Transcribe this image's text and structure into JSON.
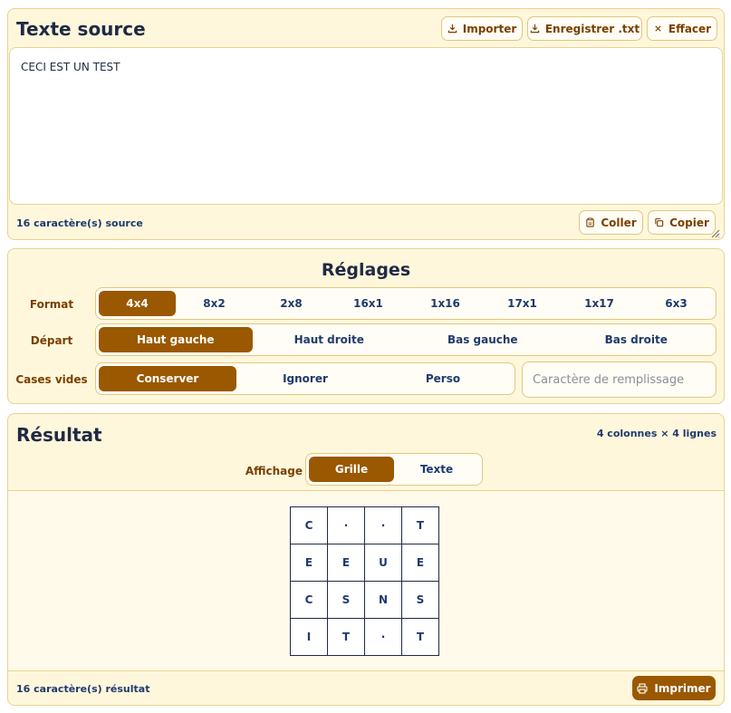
{
  "source_panel": {
    "title": "Texte source",
    "buttons": {
      "import": "Importer",
      "save": "Enregistrer .txt",
      "clear": "Effacer",
      "paste": "Coller",
      "copy": "Copier"
    },
    "text": "CECI EST UN TEST",
    "char_count": "16 caractère(s) source"
  },
  "settings_panel": {
    "title": "Réglages",
    "format": {
      "label": "Format",
      "options": [
        "4x4",
        "8x2",
        "2x8",
        "16x1",
        "1x16",
        "17x1",
        "1x17",
        "6x3"
      ],
      "selected": "4x4"
    },
    "start": {
      "label": "Départ",
      "options": [
        "Haut gauche",
        "Haut droite",
        "Bas gauche",
        "Bas droite"
      ],
      "selected": "Haut gauche"
    },
    "empty_cells": {
      "label": "Cases vides",
      "options": [
        "Conserver",
        "Ignorer",
        "Perso"
      ],
      "selected": "Conserver",
      "fill_placeholder": "Caractère de remplissage",
      "fill_value": ""
    }
  },
  "result_panel": {
    "title": "Résultat",
    "dimensions": "4 colonnes × 4 lignes",
    "view": {
      "label": "Affichage",
      "options": [
        "Grille",
        "Texte"
      ],
      "selected": "Grille"
    },
    "grid": [
      [
        "C",
        "·",
        "·",
        "T"
      ],
      [
        "E",
        "E",
        "U",
        "E"
      ],
      [
        "C",
        "S",
        "N",
        "S"
      ],
      [
        "I",
        "T",
        "·",
        "T"
      ]
    ],
    "char_count": "16 caractère(s) résultat",
    "print_label": "Imprimer"
  },
  "colors": {
    "accent": "#9a5800",
    "panel_bg": "#fff7dc",
    "border": "#e8d38e",
    "text_dark": "#1f2a44"
  },
  "icons": {
    "import": "download-icon",
    "save": "download-icon",
    "clear": "close-icon",
    "paste": "clipboard-icon",
    "copy": "copy-icon",
    "print": "printer-icon"
  }
}
